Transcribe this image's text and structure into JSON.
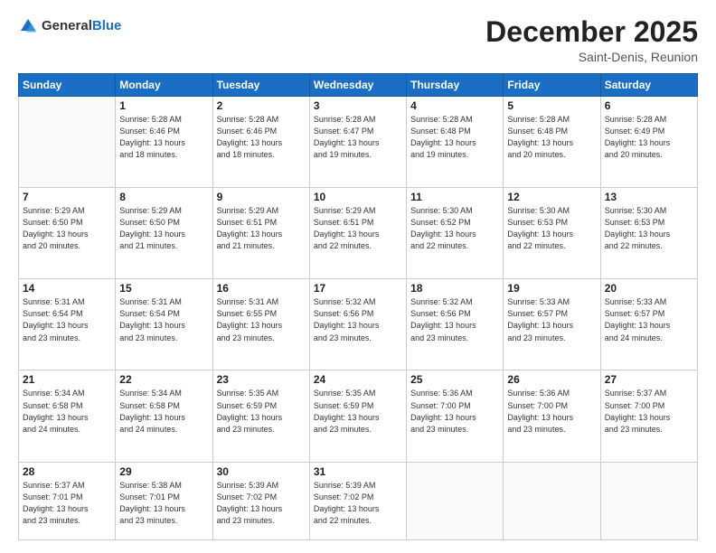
{
  "header": {
    "logo_general": "General",
    "logo_blue": "Blue",
    "month_title": "December 2025",
    "subtitle": "Saint-Denis, Reunion"
  },
  "weekdays": [
    "Sunday",
    "Monday",
    "Tuesday",
    "Wednesday",
    "Thursday",
    "Friday",
    "Saturday"
  ],
  "weeks": [
    [
      {
        "day": "",
        "info": ""
      },
      {
        "day": "1",
        "info": "Sunrise: 5:28 AM\nSunset: 6:46 PM\nDaylight: 13 hours\nand 18 minutes."
      },
      {
        "day": "2",
        "info": "Sunrise: 5:28 AM\nSunset: 6:46 PM\nDaylight: 13 hours\nand 18 minutes."
      },
      {
        "day": "3",
        "info": "Sunrise: 5:28 AM\nSunset: 6:47 PM\nDaylight: 13 hours\nand 19 minutes."
      },
      {
        "day": "4",
        "info": "Sunrise: 5:28 AM\nSunset: 6:48 PM\nDaylight: 13 hours\nand 19 minutes."
      },
      {
        "day": "5",
        "info": "Sunrise: 5:28 AM\nSunset: 6:48 PM\nDaylight: 13 hours\nand 20 minutes."
      },
      {
        "day": "6",
        "info": "Sunrise: 5:28 AM\nSunset: 6:49 PM\nDaylight: 13 hours\nand 20 minutes."
      }
    ],
    [
      {
        "day": "7",
        "info": "Sunrise: 5:29 AM\nSunset: 6:50 PM\nDaylight: 13 hours\nand 20 minutes."
      },
      {
        "day": "8",
        "info": "Sunrise: 5:29 AM\nSunset: 6:50 PM\nDaylight: 13 hours\nand 21 minutes."
      },
      {
        "day": "9",
        "info": "Sunrise: 5:29 AM\nSunset: 6:51 PM\nDaylight: 13 hours\nand 21 minutes."
      },
      {
        "day": "10",
        "info": "Sunrise: 5:29 AM\nSunset: 6:51 PM\nDaylight: 13 hours\nand 22 minutes."
      },
      {
        "day": "11",
        "info": "Sunrise: 5:30 AM\nSunset: 6:52 PM\nDaylight: 13 hours\nand 22 minutes."
      },
      {
        "day": "12",
        "info": "Sunrise: 5:30 AM\nSunset: 6:53 PM\nDaylight: 13 hours\nand 22 minutes."
      },
      {
        "day": "13",
        "info": "Sunrise: 5:30 AM\nSunset: 6:53 PM\nDaylight: 13 hours\nand 22 minutes."
      }
    ],
    [
      {
        "day": "14",
        "info": "Sunrise: 5:31 AM\nSunset: 6:54 PM\nDaylight: 13 hours\nand 23 minutes."
      },
      {
        "day": "15",
        "info": "Sunrise: 5:31 AM\nSunset: 6:54 PM\nDaylight: 13 hours\nand 23 minutes."
      },
      {
        "day": "16",
        "info": "Sunrise: 5:31 AM\nSunset: 6:55 PM\nDaylight: 13 hours\nand 23 minutes."
      },
      {
        "day": "17",
        "info": "Sunrise: 5:32 AM\nSunset: 6:56 PM\nDaylight: 13 hours\nand 23 minutes."
      },
      {
        "day": "18",
        "info": "Sunrise: 5:32 AM\nSunset: 6:56 PM\nDaylight: 13 hours\nand 23 minutes."
      },
      {
        "day": "19",
        "info": "Sunrise: 5:33 AM\nSunset: 6:57 PM\nDaylight: 13 hours\nand 23 minutes."
      },
      {
        "day": "20",
        "info": "Sunrise: 5:33 AM\nSunset: 6:57 PM\nDaylight: 13 hours\nand 24 minutes."
      }
    ],
    [
      {
        "day": "21",
        "info": "Sunrise: 5:34 AM\nSunset: 6:58 PM\nDaylight: 13 hours\nand 24 minutes."
      },
      {
        "day": "22",
        "info": "Sunrise: 5:34 AM\nSunset: 6:58 PM\nDaylight: 13 hours\nand 24 minutes."
      },
      {
        "day": "23",
        "info": "Sunrise: 5:35 AM\nSunset: 6:59 PM\nDaylight: 13 hours\nand 23 minutes."
      },
      {
        "day": "24",
        "info": "Sunrise: 5:35 AM\nSunset: 6:59 PM\nDaylight: 13 hours\nand 23 minutes."
      },
      {
        "day": "25",
        "info": "Sunrise: 5:36 AM\nSunset: 7:00 PM\nDaylight: 13 hours\nand 23 minutes."
      },
      {
        "day": "26",
        "info": "Sunrise: 5:36 AM\nSunset: 7:00 PM\nDaylight: 13 hours\nand 23 minutes."
      },
      {
        "day": "27",
        "info": "Sunrise: 5:37 AM\nSunset: 7:00 PM\nDaylight: 13 hours\nand 23 minutes."
      }
    ],
    [
      {
        "day": "28",
        "info": "Sunrise: 5:37 AM\nSunset: 7:01 PM\nDaylight: 13 hours\nand 23 minutes."
      },
      {
        "day": "29",
        "info": "Sunrise: 5:38 AM\nSunset: 7:01 PM\nDaylight: 13 hours\nand 23 minutes."
      },
      {
        "day": "30",
        "info": "Sunrise: 5:39 AM\nSunset: 7:02 PM\nDaylight: 13 hours\nand 23 minutes."
      },
      {
        "day": "31",
        "info": "Sunrise: 5:39 AM\nSunset: 7:02 PM\nDaylight: 13 hours\nand 22 minutes."
      },
      {
        "day": "",
        "info": ""
      },
      {
        "day": "",
        "info": ""
      },
      {
        "day": "",
        "info": ""
      }
    ]
  ]
}
